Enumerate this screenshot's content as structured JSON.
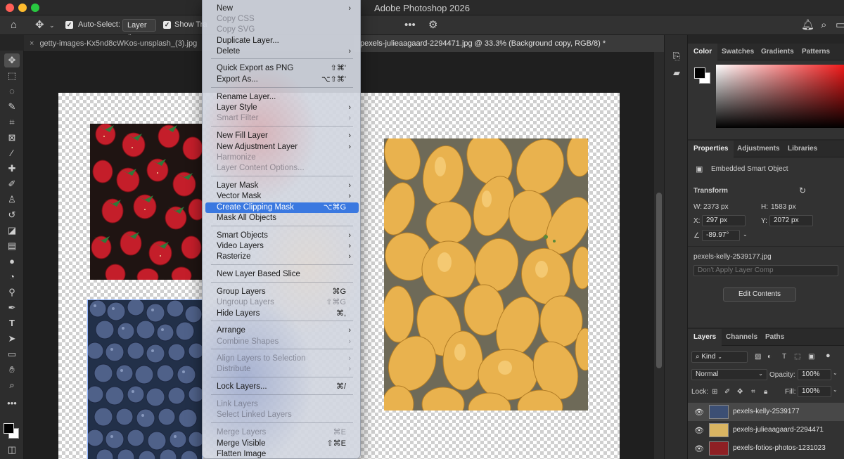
{
  "window": {
    "title": "Adobe Photoshop 2026"
  },
  "options_bar": {
    "auto_select_label": "Auto-Select:",
    "auto_select_value": "Layer",
    "show_transform_label": "Show Tra",
    "icons": [
      "home-icon",
      "move-icon",
      "more-icon",
      "gear-icon",
      "bell-icon",
      "search-icon",
      "workspace-icon"
    ]
  },
  "doc_tabs": [
    {
      "label": "getty-images-Kx5nd8cWKos-unsplash_(3).jpg",
      "active": false
    },
    {
      "label": "pexels-julieaagaard-2294471.jpg @ 33.3% (Background copy, RGB/8) *",
      "active": true
    }
  ],
  "context_menu": {
    "items": [
      {
        "label": "New",
        "shortcut": "",
        "submenu": true,
        "disabled": false
      },
      {
        "label": "Copy CSS",
        "shortcut": "",
        "submenu": false,
        "disabled": true
      },
      {
        "label": "Copy SVG",
        "shortcut": "",
        "submenu": false,
        "disabled": true
      },
      {
        "label": "Duplicate Layer...",
        "shortcut": "",
        "submenu": false,
        "disabled": false
      },
      {
        "label": "Delete",
        "shortcut": "",
        "submenu": true,
        "disabled": false
      },
      {
        "label": "Quick Export as PNG",
        "shortcut": "⇧⌘'",
        "submenu": false,
        "disabled": false
      },
      {
        "label": "Export As...",
        "shortcut": "⌥⇧⌘'",
        "submenu": false,
        "disabled": false
      },
      {
        "label": "Rename Layer...",
        "shortcut": "",
        "submenu": false,
        "disabled": false
      },
      {
        "label": "Layer Style",
        "shortcut": "",
        "submenu": true,
        "disabled": false
      },
      {
        "label": "Smart Filter",
        "shortcut": "",
        "submenu": true,
        "disabled": true
      },
      {
        "label": "New Fill Layer",
        "shortcut": "",
        "submenu": true,
        "disabled": false
      },
      {
        "label": "New Adjustment Layer",
        "shortcut": "",
        "submenu": true,
        "disabled": false
      },
      {
        "label": "Harmonize",
        "shortcut": "",
        "submenu": false,
        "disabled": true
      },
      {
        "label": "Layer Content Options...",
        "shortcut": "",
        "submenu": false,
        "disabled": true
      },
      {
        "label": "Layer Mask",
        "shortcut": "",
        "submenu": true,
        "disabled": false
      },
      {
        "label": "Vector Mask",
        "shortcut": "",
        "submenu": true,
        "disabled": false
      },
      {
        "label": "Create Clipping Mask",
        "shortcut": "⌥⌘G",
        "submenu": false,
        "disabled": false,
        "highlighted": true
      },
      {
        "label": "Mask All Objects",
        "shortcut": "",
        "submenu": false,
        "disabled": false
      },
      {
        "label": "Smart Objects",
        "shortcut": "",
        "submenu": true,
        "disabled": false
      },
      {
        "label": "Video Layers",
        "shortcut": "",
        "submenu": true,
        "disabled": false
      },
      {
        "label": "Rasterize",
        "shortcut": "",
        "submenu": true,
        "disabled": false
      },
      {
        "label": "New Layer Based Slice",
        "shortcut": "",
        "submenu": false,
        "disabled": false
      },
      {
        "label": "Group Layers",
        "shortcut": "⌘G",
        "submenu": false,
        "disabled": false
      },
      {
        "label": "Ungroup Layers",
        "shortcut": "⇧⌘G",
        "submenu": false,
        "disabled": true
      },
      {
        "label": "Hide Layers",
        "shortcut": "⌘,",
        "submenu": false,
        "disabled": false
      },
      {
        "label": "Arrange",
        "shortcut": "",
        "submenu": true,
        "disabled": false
      },
      {
        "label": "Combine Shapes",
        "shortcut": "",
        "submenu": true,
        "disabled": true
      },
      {
        "label": "Align Layers to Selection",
        "shortcut": "",
        "submenu": true,
        "disabled": true
      },
      {
        "label": "Distribute",
        "shortcut": "",
        "submenu": true,
        "disabled": true
      },
      {
        "label": "Lock Layers...",
        "shortcut": "⌘/",
        "submenu": false,
        "disabled": false
      },
      {
        "label": "Link Layers",
        "shortcut": "",
        "submenu": false,
        "disabled": true
      },
      {
        "label": "Select Linked Layers",
        "shortcut": "",
        "submenu": false,
        "disabled": true
      },
      {
        "label": "Merge Layers",
        "shortcut": "⌘E",
        "submenu": false,
        "disabled": true
      },
      {
        "label": "Merge Visible",
        "shortcut": "⇧⌘E",
        "submenu": false,
        "disabled": false
      },
      {
        "label": "Flatten Image",
        "shortcut": "",
        "submenu": false,
        "disabled": false
      }
    ]
  },
  "color_panel": {
    "tabs": [
      "Color",
      "Swatches",
      "Gradients",
      "Patterns"
    ]
  },
  "properties_panel": {
    "tabs": [
      "Properties",
      "Adjustments",
      "Libraries"
    ],
    "object_type": "Embedded Smart Object",
    "transform_label": "Transform",
    "w_label": "W:",
    "w_value": "2373 px",
    "h_label": "H:",
    "h_value": "1583 px",
    "x_label": "X:",
    "x_value": "297 px",
    "y_label": "Y:",
    "y_value": "2072 px",
    "angle_value": "-89.97°",
    "file_name": "pexels-kelly-2539177.jpg",
    "layer_comp_placeholder": "Don't Apply Layer Comp",
    "edit_button": "Edit Contents"
  },
  "layers_panel": {
    "tabs": [
      "Layers",
      "Channels",
      "Paths"
    ],
    "filter_kind": "Kind",
    "blend_mode": "Normal",
    "opacity_label": "Opacity:",
    "opacity_value": "100%",
    "lock_label": "Lock:",
    "fill_label": "Fill:",
    "fill_value": "100%",
    "layers": [
      {
        "name": "pexels-kelly-2539177",
        "active": true
      },
      {
        "name": "pexels-julieaagaard-2294471",
        "active": false
      },
      {
        "name": "pexels-fotios-photos-1231023",
        "active": false
      }
    ]
  },
  "colors": {
    "accent": "#3a78e0",
    "foreground": "#000000",
    "background": "#ffffff"
  }
}
